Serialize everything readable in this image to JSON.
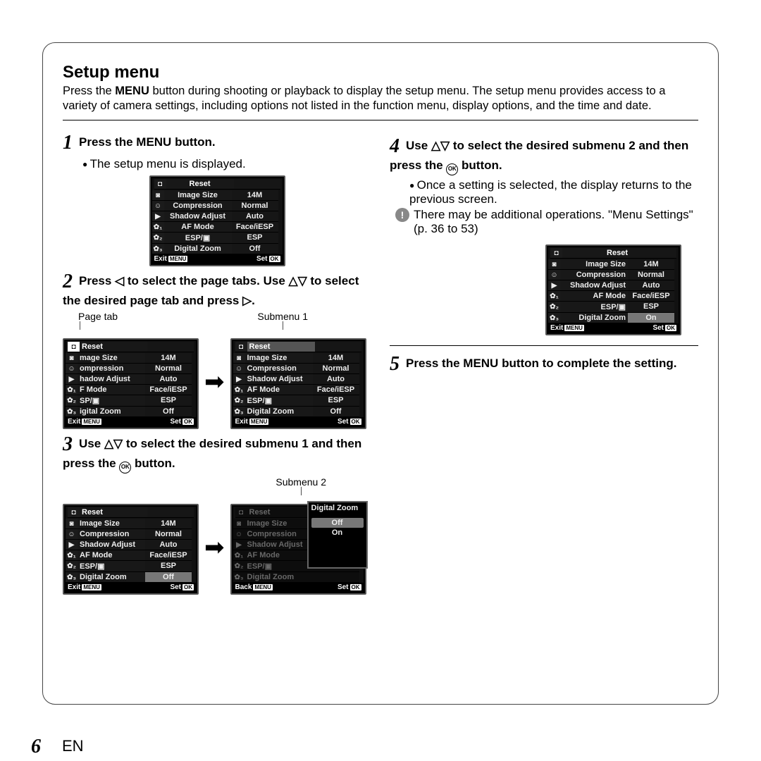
{
  "page": {
    "number": "6",
    "lang": "EN"
  },
  "heading": "Setup menu",
  "intro": {
    "prefix": "Press the ",
    "menu_word": "MENU",
    "rest": " button during shooting or playback to display the setup menu. The setup menu provides access to a variety of camera settings, including options not listed in the function menu, display options, and the time and date."
  },
  "menu_chip": "MENU",
  "ok_chip": "OK",
  "ok_text": "OK",
  "glyphs": {
    "left": "◁",
    "right": "▷",
    "up": "△",
    "down": "▽"
  },
  "steps": {
    "s1": {
      "num": "1",
      "title_prefix": "Press the ",
      "title_bold": "MENU",
      "title_suffix": " button.",
      "sub": "The setup menu is displayed."
    },
    "s2": {
      "num": "2",
      "t1": "Press ",
      "t2": " to select the page tabs. Use ",
      "t3": " to select the desired page tab and press ",
      "t4": ".",
      "label_left": "Page tab",
      "label_right": "Submenu 1"
    },
    "s3": {
      "num": "3",
      "t1": "Use ",
      "t2": " to select the desired submenu 1 and then press the ",
      "t3": " button.",
      "label_right": "Submenu 2"
    },
    "s4": {
      "num": "4",
      "t1": "Use ",
      "t2": " to select the desired submenu 2 and then press the ",
      "t3": " button.",
      "sub": "Once a setting is selected, the display returns to the previous screen.",
      "note": "There may be additional operations. \"Menu Settings\" (p. 36 to 53)"
    },
    "s5": {
      "num": "5",
      "t1": "Press the ",
      "t2": "MENU",
      "t3": " button to complete the setting."
    }
  },
  "screen_common": {
    "title": "Reset",
    "footer_exit": "Exit",
    "footer_back": "Back",
    "footer_set": "Set"
  },
  "tab_icons": [
    "◘",
    "◙",
    "☺",
    "▶",
    "✿₁",
    "✿₂",
    "✿₃"
  ],
  "screens": {
    "step1": {
      "rows": [
        [
          "Image Size",
          "14M"
        ],
        [
          "Compression",
          "Normal"
        ],
        [
          "Shadow Adjust",
          "Auto"
        ],
        [
          "AF Mode",
          "Face/iESP"
        ],
        [
          "ESP/▣",
          "ESP"
        ],
        [
          "Digital Zoom",
          "Off"
        ]
      ]
    },
    "step2_left": {
      "rows": [
        [
          "Image Size",
          "14M"
        ],
        [
          "Compression",
          "Normal"
        ],
        [
          "Shadow Adjust",
          "Auto"
        ],
        [
          "AF Mode",
          "Face/iESP"
        ],
        [
          "ESP/▣",
          "ESP"
        ],
        [
          "Digital Zoom",
          "Off"
        ]
      ],
      "truncate_left": true
    },
    "step2_right": {
      "rows": [
        [
          "Image Size",
          "14M"
        ],
        [
          "Compression",
          "Normal"
        ],
        [
          "Shadow Adjust",
          "Auto"
        ],
        [
          "AF Mode",
          "Face/iESP"
        ],
        [
          "ESP/▣",
          "ESP"
        ],
        [
          "Digital Zoom",
          "Off"
        ]
      ]
    },
    "step3_left": {
      "rows": [
        [
          "Image Size",
          "14M"
        ],
        [
          "Compression",
          "Normal"
        ],
        [
          "Shadow Adjust",
          "Auto"
        ],
        [
          "AF Mode",
          "Face/iESP"
        ],
        [
          "ESP/▣",
          "ESP"
        ],
        [
          "Digital Zoom",
          "Off"
        ]
      ],
      "highlight_row": 5
    },
    "step3_right": {
      "rows": [
        [
          "Image Size",
          ""
        ],
        [
          "Compression",
          ""
        ],
        [
          "Shadow Adjust",
          ""
        ],
        [
          "AF Mode",
          ""
        ],
        [
          "ESP/▣",
          ""
        ],
        [
          "Digital Zoom",
          ""
        ]
      ],
      "dim": true,
      "popup_title": "Digital Zoom",
      "popup_options": [
        "Off",
        "On"
      ],
      "popup_selected": 0
    },
    "step4": {
      "rows": [
        [
          "Image Size",
          "14M"
        ],
        [
          "Compression",
          "Normal"
        ],
        [
          "Shadow Adjust",
          "Auto"
        ],
        [
          "AF Mode",
          "Face/iESP"
        ],
        [
          "ESP/▣",
          "ESP"
        ],
        [
          "Digital Zoom",
          "On"
        ]
      ],
      "highlight_row": 5
    }
  }
}
